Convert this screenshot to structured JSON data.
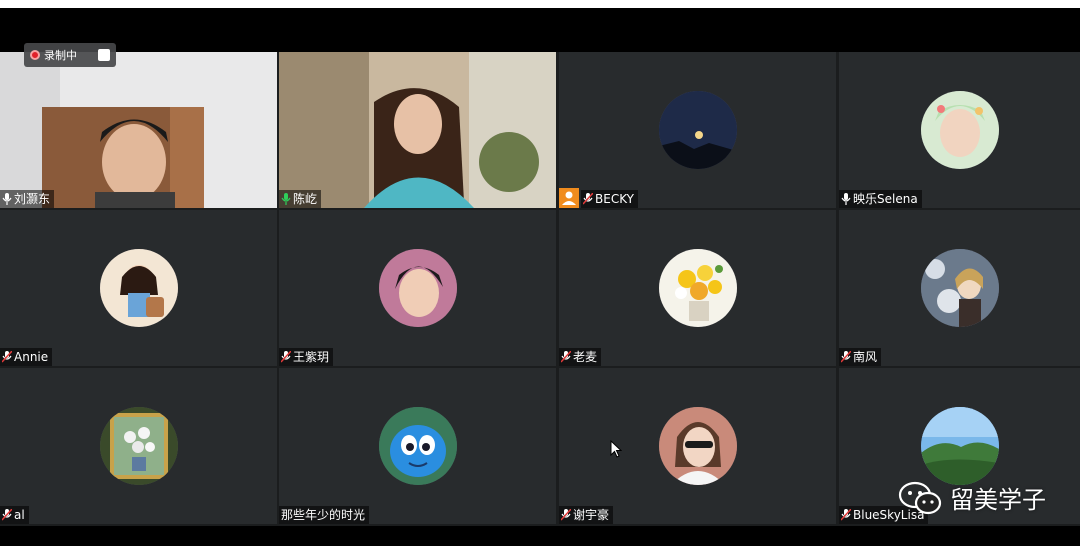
{
  "recording": {
    "label": "录制中"
  },
  "watermark": {
    "text": "留美学子"
  },
  "participants": [
    {
      "name": "刘灏东",
      "mic": "on",
      "video": true
    },
    {
      "name": "陈屹",
      "mic": "on-green",
      "video": true,
      "active_speaker": true
    },
    {
      "name": "BECKY",
      "mic": "muted",
      "host": true,
      "avatar": "moon-night"
    },
    {
      "name": "映乐Selena",
      "mic": "on",
      "avatar": "anime-portrait"
    },
    {
      "name": "Annie",
      "mic": "muted",
      "avatar": "cartoon-girl"
    },
    {
      "name": "王紫玥",
      "mic": "muted",
      "avatar": "young-man"
    },
    {
      "name": "老麦",
      "mic": "muted",
      "avatar": "flowers-vase"
    },
    {
      "name": "南风",
      "mic": "muted",
      "avatar": "anime-snow"
    },
    {
      "name": "al",
      "mic": "muted",
      "avatar": "painting-flowers"
    },
    {
      "name": "那些年少的时光",
      "mic": "none",
      "avatar": "blue-cartoon"
    },
    {
      "name": "谢宇豪",
      "mic": "muted",
      "avatar": "woman-sunglasses"
    },
    {
      "name": "BlueSkyLisa",
      "mic": "muted",
      "avatar": "mountain-sky"
    }
  ],
  "colors": {
    "tile_bg": "#282b2d",
    "active_speaker": "#1f8e4a",
    "host_badge": "#f08c1e",
    "recording_dot": "#e0202a"
  }
}
